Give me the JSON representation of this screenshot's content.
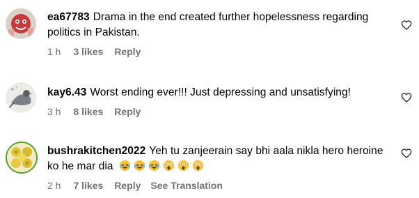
{
  "comments": [
    {
      "username": "ea67783",
      "text": "Drama in the end created further hopelessness regarding politics in Pakistan.",
      "time": "1 h",
      "likes": "3 likes",
      "reply": "Reply",
      "avatar": "avatar-red-cartoon"
    },
    {
      "username": "kay6.43",
      "text": "Worst ending ever!!! Just depressing and unsatisfying!",
      "time": "3 h",
      "likes": "8 likes",
      "reply": "Reply",
      "avatar": "avatar-bird-sketch"
    },
    {
      "username": "bushrakitchen2022",
      "text": "Yeh tu zanjeerain say bhi aala nikla hero heroine ko he mar dia",
      "time": "2 h",
      "likes": "7 likes",
      "reply": "Reply",
      "translation": "See Translation",
      "avatar": "avatar-food-bowls",
      "emojis": [
        "laughing-crying",
        "laughing-crying",
        "laughing-crying",
        "shocked",
        "shocked",
        "shocked"
      ]
    }
  ],
  "colors": {
    "text": "#000000",
    "meta": "#737373",
    "avatar_ring": "#5aa02c"
  },
  "icons": {
    "like": "heart-outline-icon"
  }
}
